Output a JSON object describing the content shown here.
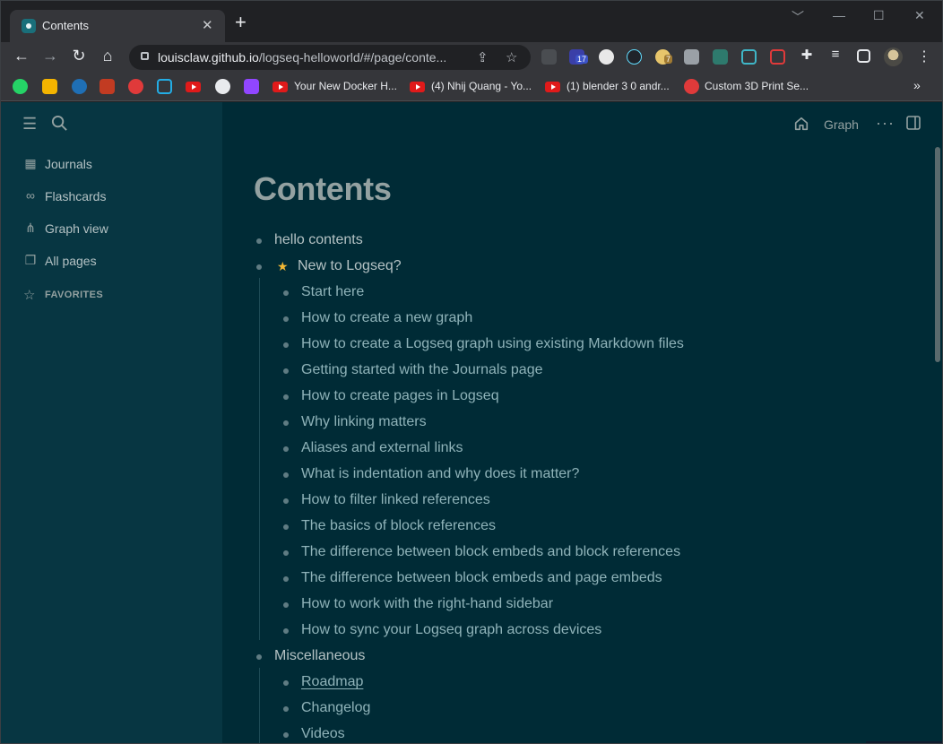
{
  "browser": {
    "tab_title": "Contents",
    "tab_close": "✕",
    "new_tab": "+",
    "window_controls": {
      "collapse": "﹀",
      "minimize": "—",
      "maximize": "☐",
      "close": "✕"
    },
    "url_host": "louisclaw.github.io",
    "url_path": "/logseq-helloworld/#/page/conte...",
    "extension_badges": [
      "17",
      "7"
    ],
    "bookmarks": [
      "Your New Docker H...",
      "(4) Nhij Quang - Yo...",
      "(1) blender 3 0 andr...",
      "Custom 3D Print Se..."
    ],
    "bookmarks_more": "»"
  },
  "sidebar": {
    "items": [
      {
        "label": "Journals",
        "icon": "calendar-icon"
      },
      {
        "label": "Flashcards",
        "icon": "infinity-icon"
      },
      {
        "label": "Graph view",
        "icon": "graph-icon"
      },
      {
        "label": "All pages",
        "icon": "pages-icon"
      }
    ],
    "favorites_label": "FAVORITES"
  },
  "header": {
    "graph_label": "Graph"
  },
  "page": {
    "title": "Contents",
    "blocks": [
      {
        "text": "hello contents"
      },
      {
        "text": "New to Logseq?",
        "star": "★",
        "children": [
          "Start here",
          "How to create a new graph",
          "How to create a Logseq graph using existing Markdown files",
          "Getting started with the Journals page",
          "How to create pages in Logseq",
          "Why linking matters",
          "Aliases and external links",
          "What is indentation and why does it matter?",
          "How to filter linked references",
          "The basics of block references",
          "The difference between block embeds and block references",
          "The difference between block embeds and page embeds",
          "How to work with the right-hand sidebar",
          "How to sync your Logseq graph across devices"
        ]
      },
      {
        "text": "Miscellaneous",
        "children": [
          "Roadmap",
          "Changelog",
          "Videos"
        ]
      }
    ]
  }
}
